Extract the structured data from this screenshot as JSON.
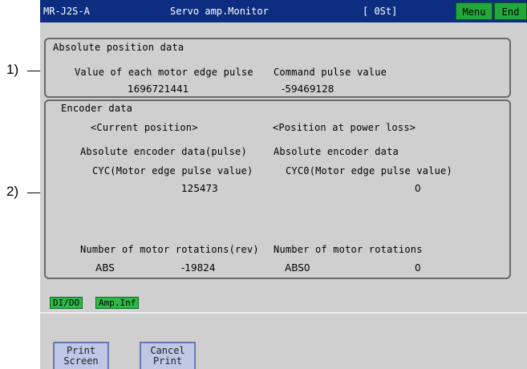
{
  "titlebar": {
    "model": "MR-J2S-A",
    "title": "Servo amp.Monitor",
    "station": "[ 0St]",
    "menu_label": "Menu",
    "end_label": "End"
  },
  "callouts": {
    "first": "1)",
    "second": "2)"
  },
  "absolute_position": {
    "heading": "Absolute position data",
    "motor_pulse_label": "Value of each motor edge pulse",
    "motor_pulse_value": "1696721441",
    "command_pulse_label": "Command pulse value",
    "command_pulse_value": "-59469128"
  },
  "encoder": {
    "heading": "Encoder data",
    "current_header": "<Current position>",
    "power_loss_header": "<Position at power loss>",
    "abs_data_label": "Absolute encoder data(pulse)",
    "abs_data_label_loss": "Absolute encoder data",
    "cyc_label": "CYC(Motor edge pulse value)",
    "cyc0_label": "CYC0(Motor edge pulse value)",
    "cyc_value": "125473",
    "cyc0_value": "0",
    "rotations_label": "Number of motor rotations(rev)",
    "rotations_label_loss": "Number of motor rotations",
    "abs_label": "ABS",
    "abs_value": "-19824",
    "abs0_label": "ABS0",
    "abs0_value": "0"
  },
  "tabs": {
    "dio": "DI/DO",
    "amp": "Amp.Inf"
  },
  "buttons": {
    "print_line1": "Print",
    "print_line2": "Screen",
    "cancel_line1": "Cancel",
    "cancel_line2": "Print"
  },
  "colors": {
    "titlebar": "#0d2e80",
    "menu_button": "#22a83a",
    "screen_bg": "#cfcfcf",
    "function_button": "#bfc6e6"
  }
}
